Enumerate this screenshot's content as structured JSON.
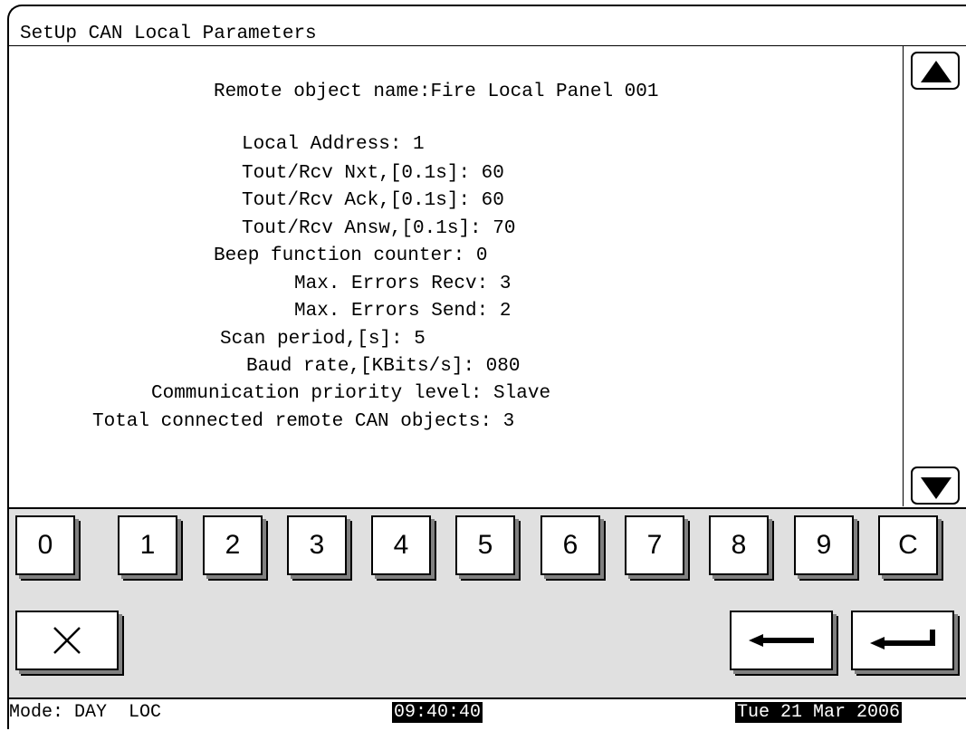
{
  "window": {
    "title": "SetUp CAN Local Parameters"
  },
  "parameters": [
    "Remote object name:Fire Local Panel 001",
    "Local Address: 1",
    "Tout/Rcv Nxt,[0.1s]: 60",
    "Tout/Rcv Ack,[0.1s]: 60",
    "Tout/Rcv Answ,[0.1s]: 70",
    "Beep function counter: 0",
    "Max. Errors Recv: 3",
    "Max. Errors Send: 2",
    "Scan period,[s]: 5",
    "Baud rate,[KBits/s]: 080",
    "Communication priority level: Slave",
    "Total connected remote CAN objects: 3"
  ],
  "scroll": {
    "up_icon": "triangle-up-icon",
    "down_icon": "triangle-down-icon"
  },
  "keypad": {
    "keys": [
      "0",
      "1",
      "2",
      "3",
      "4",
      "5",
      "6",
      "7",
      "8",
      "9",
      "C"
    ],
    "cancel_icon": "x-icon",
    "backspace_icon": "arrow-left-icon",
    "enter_icon": "enter-arrow-icon"
  },
  "status": {
    "mode": "Mode: DAY  LOC",
    "time": "09:40:40",
    "date": "Tue 21 Mar 2006"
  }
}
